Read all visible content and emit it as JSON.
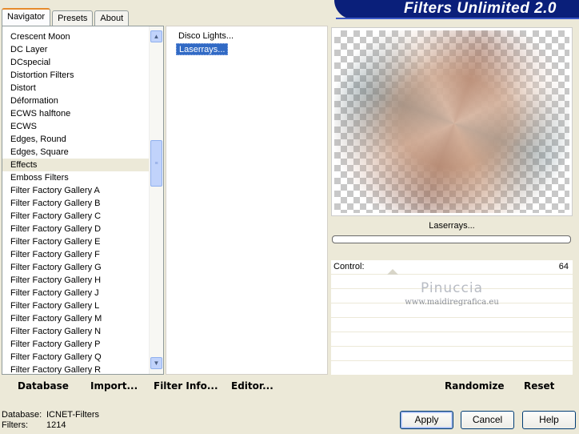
{
  "tabs": [
    {
      "label": "Navigator",
      "active": true
    },
    {
      "label": "Presets",
      "active": false
    },
    {
      "label": "About",
      "active": false
    }
  ],
  "banner": {
    "title": "Filters Unlimited 2.0"
  },
  "categories": {
    "items": [
      "Crescent Moon",
      "DC Layer",
      "DCspecial",
      "Distortion Filters",
      "Distort",
      "Déformation",
      "ECWS halftone",
      "ECWS",
      "Edges, Round",
      "Edges, Square",
      "Effects",
      "Emboss Filters",
      "Filter Factory Gallery A",
      "Filter Factory Gallery B",
      "Filter Factory Gallery C",
      "Filter Factory Gallery D",
      "Filter Factory Gallery E",
      "Filter Factory Gallery F",
      "Filter Factory Gallery G",
      "Filter Factory Gallery H",
      "Filter Factory Gallery J",
      "Filter Factory Gallery L",
      "Filter Factory Gallery M",
      "Filter Factory Gallery N",
      "Filter Factory Gallery P",
      "Filter Factory Gallery Q",
      "Filter Factory Gallery R"
    ],
    "selected_index": 10
  },
  "filters": {
    "items": [
      "Disco Lights...",
      "Laserrays..."
    ],
    "selected_index": 1
  },
  "preview": {
    "filter_name": "Laserrays..."
  },
  "controls": [
    {
      "label": "Control:",
      "value": "64"
    }
  ],
  "watermark": {
    "name": "Pinuccia",
    "url": "www.maidiregrafica.eu"
  },
  "toolbar": {
    "database": "Database",
    "import": "Import...",
    "filter_info": "Filter Info...",
    "editor": "Editor...",
    "randomize": "Randomize",
    "reset": "Reset"
  },
  "status": {
    "database_label": "Database:",
    "database_value": "ICNET-Filters",
    "filters_label": "Filters:",
    "filters_value": "1214"
  },
  "buttons": {
    "apply": "Apply",
    "cancel": "Cancel",
    "help": "Help"
  },
  "colors": {
    "selection": "#316ac5",
    "banner": "#0a1f7a",
    "tab_accent": "#e68b2c"
  }
}
